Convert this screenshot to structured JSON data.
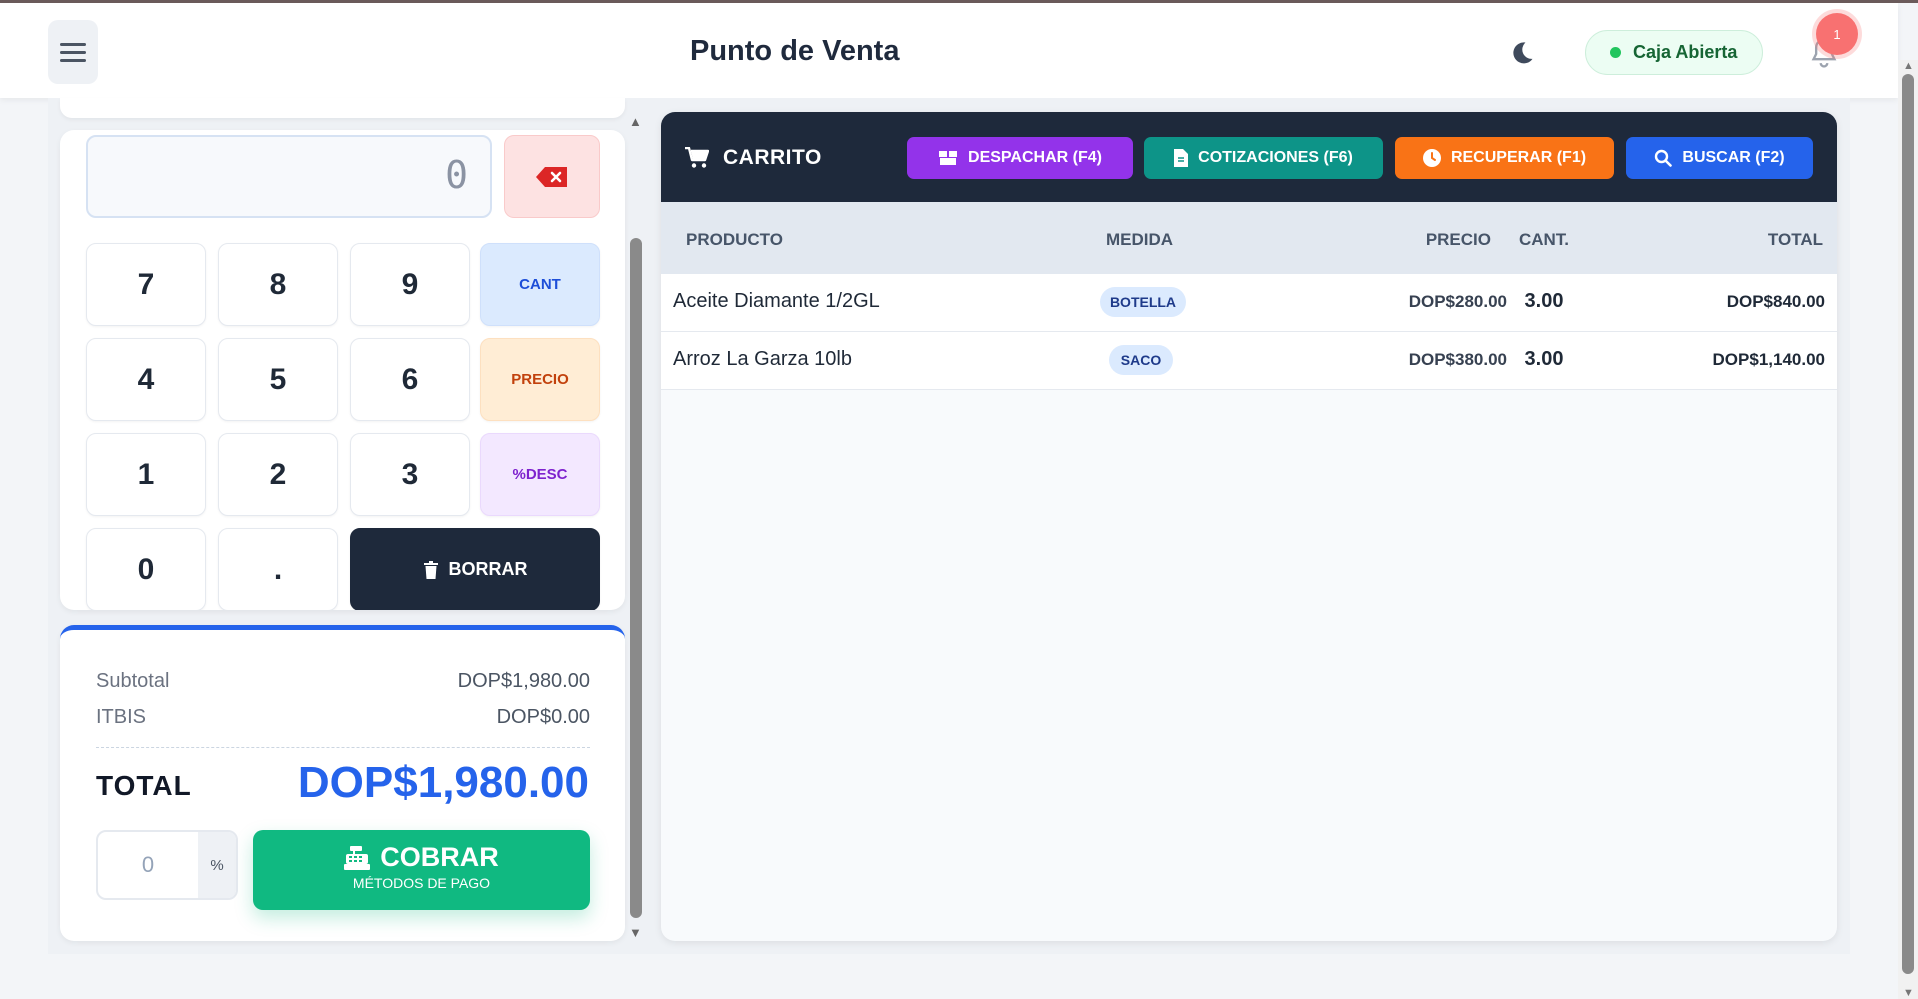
{
  "header": {
    "title": "Punto de Venta",
    "menu_icon": "hamburger-icon",
    "theme_icon": "moon-icon",
    "status_label": "Caja Abierta",
    "notification_count": "1"
  },
  "keypad": {
    "display_value": "0",
    "keys": {
      "k7": "7",
      "k8": "8",
      "k9": "9",
      "k4": "4",
      "k5": "5",
      "k6": "6",
      "k1": "1",
      "k2": "2",
      "k3": "3",
      "k0": "0",
      "kdot": ".",
      "cant": "CANT",
      "precio": "PRECIO",
      "desc": "%DESC",
      "borrar": "BORRAR"
    }
  },
  "totals": {
    "subtotal_label": "Subtotal",
    "subtotal_value": "DOP$1,980.00",
    "itbis_label": "ITBIS",
    "itbis_value": "DOP$0.00",
    "total_label": "TOTAL",
    "total_value": "DOP$1,980.00",
    "discount_value": "0",
    "discount_unit": "%",
    "cobrar_label": "COBRAR",
    "cobrar_sub": "MÉTODOS DE PAGO"
  },
  "cart": {
    "title": "CARRITO",
    "buttons": {
      "despachar": "DESPACHAR (F4)",
      "cotizaciones": "COTIZACIONES (F6)",
      "recuperar": "RECUPERAR (F1)",
      "buscar": "BUSCAR (F2)"
    },
    "columns": {
      "producto": "PRODUCTO",
      "medida": "MEDIDA",
      "precio": "PRECIO",
      "cant": "CANT.",
      "total": "TOTAL"
    },
    "rows": [
      {
        "producto": "Aceite Diamante 1/2GL",
        "medida": "BOTELLA",
        "precio": "DOP$280.00",
        "cant": "3.00",
        "total": "DOP$840.00"
      },
      {
        "producto": "Arroz La Garza 10lb",
        "medida": "SACO",
        "precio": "DOP$380.00",
        "cant": "3.00",
        "total": "DOP$1,140.00"
      }
    ]
  },
  "colors": {
    "accent": "#2563eb",
    "success": "#10b981",
    "dark": "#1e293b"
  }
}
